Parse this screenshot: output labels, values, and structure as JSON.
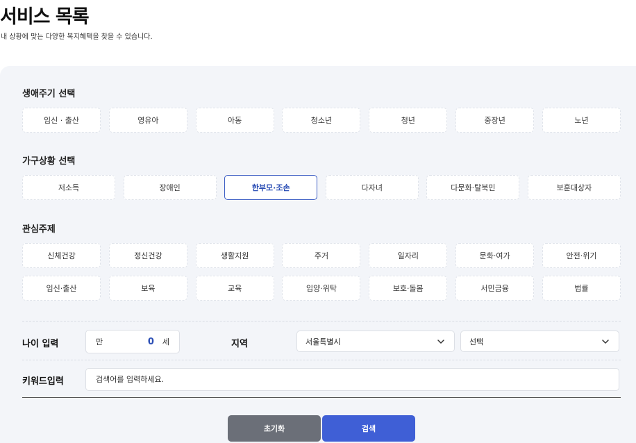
{
  "header": {
    "title": "서비스 목록",
    "subtitle": "내 상황에 맞는 다양한 복지혜택을 찾을 수 있습니다."
  },
  "lifecycle": {
    "title": "생애주기 선택",
    "items": [
      "임신 · 출산",
      "영유아",
      "아동",
      "청소년",
      "청년",
      "중장년",
      "노년"
    ]
  },
  "household": {
    "title": "가구상황 선택",
    "items": [
      "저소득",
      "장애인",
      "한부모·조손",
      "다자녀",
      "다문화·탈북민",
      "보훈대상자"
    ],
    "selected": "한부모·조손"
  },
  "interest": {
    "title": "관심주제",
    "row1": [
      "신체건강",
      "정신건강",
      "생활지원",
      "주거",
      "일자리",
      "문화·여가",
      "안전·위기"
    ],
    "row2": [
      "임신·출산",
      "보육",
      "교육",
      "입양·위탁",
      "보호·돌봄",
      "서민금융",
      "법률"
    ]
  },
  "age": {
    "label": "나이 입력",
    "prefix": "만",
    "value": "0",
    "suffix": "세"
  },
  "region": {
    "label": "지역",
    "primary": "서울특별시",
    "secondary": "선택"
  },
  "keyword": {
    "label": "키워드입력",
    "placeholder": "검색어를 입력하세요."
  },
  "buttons": {
    "reset": "초기화",
    "search": "검색"
  },
  "colors": {
    "accent": "#3f5fd6",
    "reset": "#6b6f78",
    "panel": "#f3f5f9"
  }
}
